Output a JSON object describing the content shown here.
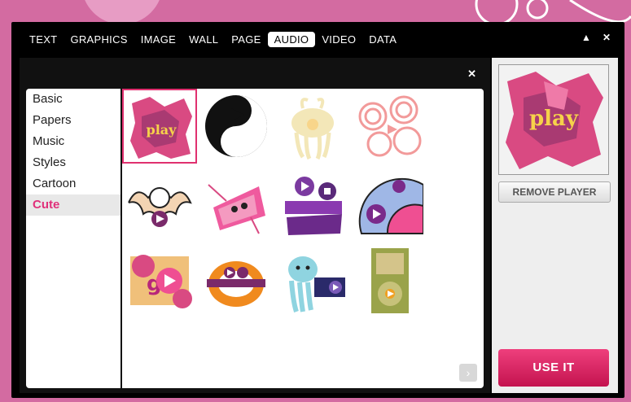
{
  "tabs": [
    {
      "label": "TEXT",
      "active": false
    },
    {
      "label": "GRAPHICS",
      "active": false
    },
    {
      "label": "IMAGE",
      "active": false
    },
    {
      "label": "WALL",
      "active": false
    },
    {
      "label": "PAGE",
      "active": false
    },
    {
      "label": "AUDIO",
      "active": true
    },
    {
      "label": "VIDEO",
      "active": false
    },
    {
      "label": "DATA",
      "active": false
    }
  ],
  "window_controls": {
    "collapse": "▲",
    "close": "✕"
  },
  "panel": {
    "close": "✕"
  },
  "categories": [
    {
      "label": "Basic",
      "active": false
    },
    {
      "label": "Papers",
      "active": false
    },
    {
      "label": "Music",
      "active": false
    },
    {
      "label": "Styles",
      "active": false
    },
    {
      "label": "Cartoon",
      "active": false
    },
    {
      "label": "Cute",
      "active": true
    }
  ],
  "players": [
    {
      "name": "play-splash",
      "selected": true
    },
    {
      "name": "yin-yang",
      "selected": false
    },
    {
      "name": "jellyfish-faded",
      "selected": false
    },
    {
      "name": "swirl-clouds",
      "selected": false
    },
    {
      "name": "bat",
      "selected": false
    },
    {
      "name": "pink-creature",
      "selected": false
    },
    {
      "name": "purple-blocks",
      "selected": false
    },
    {
      "name": "half-fan",
      "selected": false
    },
    {
      "name": "go-sticker",
      "selected": false
    },
    {
      "name": "orange-ring",
      "selected": false
    },
    {
      "name": "octopus",
      "selected": false
    },
    {
      "name": "ipod-green",
      "selected": false
    }
  ],
  "preview": {
    "text": "play"
  },
  "buttons": {
    "remove": "REMOVE PLAYER",
    "use": "USE IT",
    "next": "›"
  },
  "colors": {
    "accent": "#e0306f",
    "background": "#d36ba1"
  }
}
